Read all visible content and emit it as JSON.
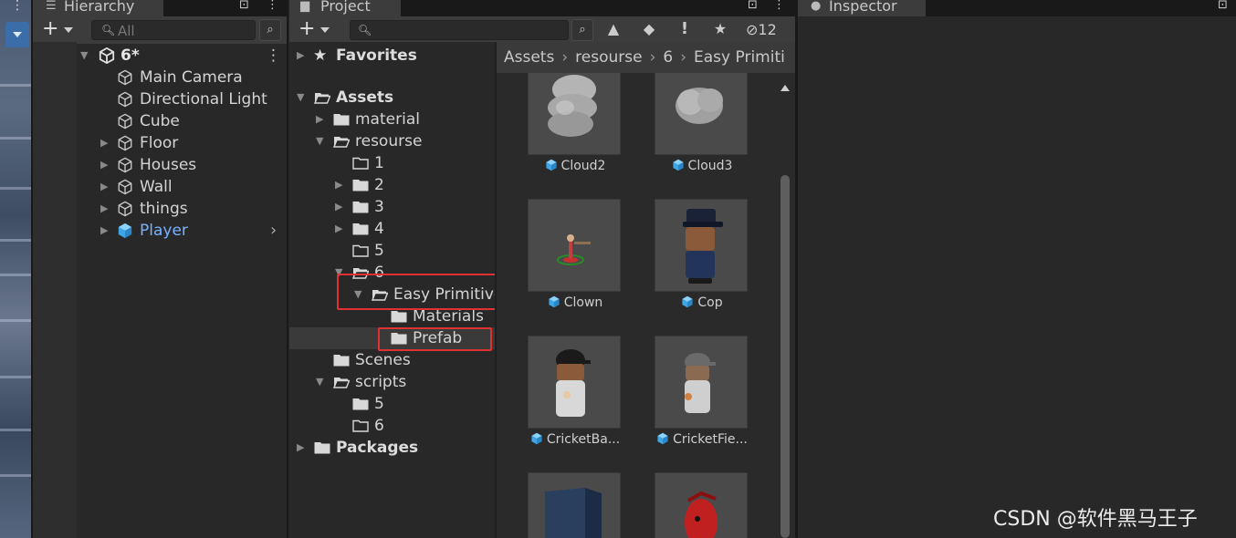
{
  "hierarchy": {
    "tab_label": "Hierarchy",
    "search_placeholder": "All",
    "scene_name": "6*",
    "items": [
      {
        "label": "Main Camera",
        "expandable": false
      },
      {
        "label": "Directional Light",
        "expandable": false
      },
      {
        "label": "Cube",
        "expandable": false
      },
      {
        "label": "Floor",
        "expandable": true
      },
      {
        "label": "Houses",
        "expandable": true
      },
      {
        "label": "Wall",
        "expandable": true
      },
      {
        "label": "things",
        "expandable": true
      },
      {
        "label": "Player",
        "expandable": true
      }
    ]
  },
  "project": {
    "tab_label": "Project",
    "hidden_count": "12",
    "tree": {
      "favorites": "Favorites",
      "assets": "Assets",
      "material": "material",
      "resourse": "resourse",
      "f1": "1",
      "f2": "2",
      "f3": "3",
      "f4": "4",
      "f5": "5",
      "f6": "6",
      "easy_primitive": "Easy Primitive",
      "materials": "Materials",
      "prefab": "Prefab",
      "scenes": "Scenes",
      "scripts": "scripts",
      "s5": "5",
      "s6": "6",
      "packages": "Packages"
    },
    "breadcrumb": [
      "Assets",
      "resourse",
      "6",
      "Easy Primiti"
    ],
    "assets": [
      {
        "label": "Cloud2"
      },
      {
        "label": "Cloud3"
      },
      {
        "label": "Clown"
      },
      {
        "label": "Cop"
      },
      {
        "label": "CricketBa..."
      },
      {
        "label": "CricketFie..."
      }
    ]
  },
  "inspector": {
    "tab_label": "Inspector"
  },
  "watermark": "CSDN @软件黑马王子",
  "colors": {
    "panel_bg": "#282828",
    "toolbar_bg": "#3c3c3c",
    "highlight_blue": "#7ab1ff",
    "prefab_blue": "#4fb4f0",
    "annotation_red": "#e03232"
  }
}
